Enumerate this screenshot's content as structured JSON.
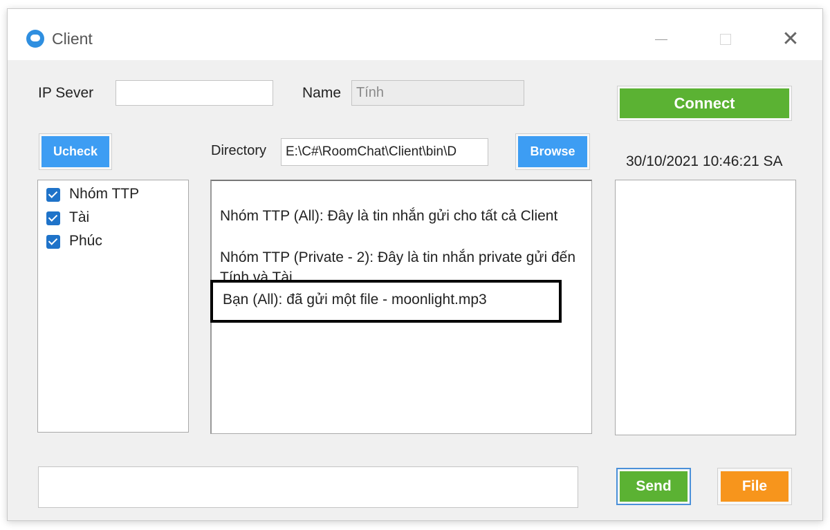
{
  "window": {
    "title": "Client",
    "icon": "chat-bubble-icon"
  },
  "form": {
    "ip_label": "IP Sever",
    "ip_value": "",
    "name_label": "Name",
    "name_value": "Tính",
    "connect_label": "Connect",
    "uncheck_label": "Ucheck",
    "directory_label": "Directory",
    "directory_value": "E:\\C#\\RoomChat\\Client\\bin\\D",
    "browse_label": "Browse",
    "datetime": "30/10/2021 10:46:21 SA",
    "message_value": "",
    "send_label": "Send",
    "file_label": "File"
  },
  "clients": [
    {
      "label": "Nhóm TTP",
      "checked": true
    },
    {
      "label": "Tài",
      "checked": true
    },
    {
      "label": "Phúc",
      "checked": true
    }
  ],
  "messages": [
    "Nhóm TTP (All): Đây là tin nhắn gửi cho tất cả Client",
    "Nhóm TTP (Private - 2): Đây là tin nhắn private gửi đến Tính và Tài",
    "Bạn (All): đã gửi một file - moonlight.mp3"
  ],
  "colors": {
    "blue": "#3d9df3",
    "green": "#5bb233",
    "orange": "#f7951c"
  }
}
